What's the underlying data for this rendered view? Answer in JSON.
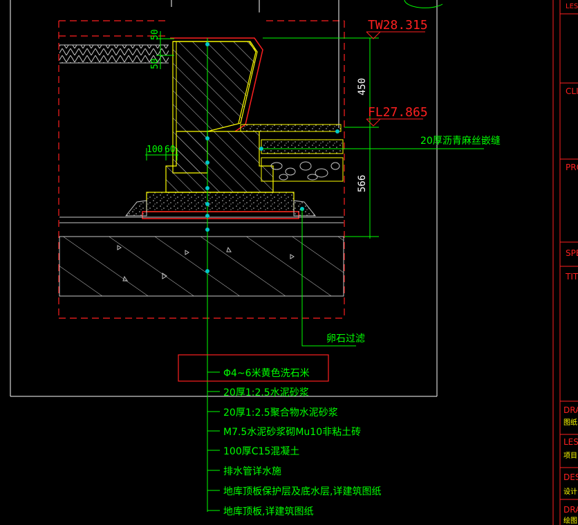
{
  "colors": {
    "background": "#000000",
    "white": "#ffffff",
    "red": "#ff2020",
    "green": "#00ff00",
    "yellow": "#ffff00",
    "cyan": "#00c8c8",
    "section_line": "#c8c8c8"
  },
  "dimensions": {
    "top_value": "50",
    "mid_value": "50",
    "width_value": "100",
    "width_value2": "60",
    "height_upper": "450",
    "height_lower": "566"
  },
  "elevations": {
    "tw": "TW28.315",
    "fl": "FL27.865"
  },
  "callouts": {
    "joint": "20厚沥青麻丝嵌缝",
    "pebble": "卵石过滤"
  },
  "layers": [
    "Φ4~6米黄色洗石米",
    "20厚1:2.5水泥砂浆",
    "20厚1:2.5聚合物水泥砂浆",
    "M7.5水泥砂浆砌Mu10非粘土砖",
    "100厚C15混凝土",
    "排水管详水施",
    "地库顶板保护层及底水层,详建筑图纸",
    "地库顶板,详建筑图纸"
  ],
  "title_block": {
    "labels": [
      "LES",
      "CLI",
      "PRO",
      "SPE",
      "TIT",
      "DRA",
      "LES",
      "DES",
      "DRA"
    ],
    "sublabels": [
      "图纸",
      "项目",
      "设计",
      "绘图"
    ]
  }
}
